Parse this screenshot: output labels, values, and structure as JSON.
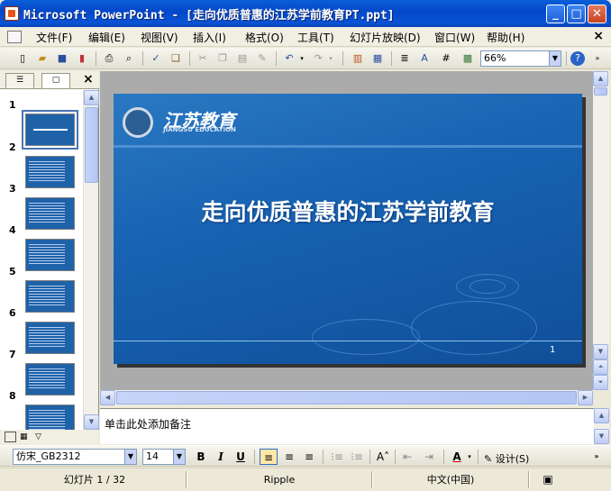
{
  "window": {
    "title": "Microsoft PowerPoint - [走向优质普惠的江苏学前教育PT.ppt]",
    "min": "_",
    "max": "□",
    "close": "✕"
  },
  "menu": {
    "items": [
      "文件(F)",
      "编辑(E)",
      "视图(V)",
      "插入(I)",
      "格式(O)",
      "工具(T)",
      "幻灯片放映(D)",
      "窗口(W)",
      "帮助(H)"
    ],
    "close": "×"
  },
  "toolbar": {
    "zoom": "66%"
  },
  "leftpane": {
    "tab_outline": "☰",
    "tab_slides": "▢",
    "close": "×",
    "thumb_numbers": [
      "1",
      "2",
      "3",
      "4",
      "5",
      "6",
      "7",
      "8"
    ]
  },
  "slide": {
    "title": "走向优质普惠的江苏学前教育",
    "logo_text": "江苏教育",
    "logo_sub": "JIANGSU EDUCATION",
    "page_number": "1"
  },
  "notes": {
    "placeholder": "单击此处添加备注"
  },
  "format": {
    "font": "仿宋_GB2312",
    "size": "14",
    "bold": "B",
    "italic": "I",
    "underline": "U",
    "design": "设计(S)"
  },
  "status": {
    "slide": "幻灯片 1 / 32",
    "template": "Ripple",
    "language": "中文(中国)"
  }
}
